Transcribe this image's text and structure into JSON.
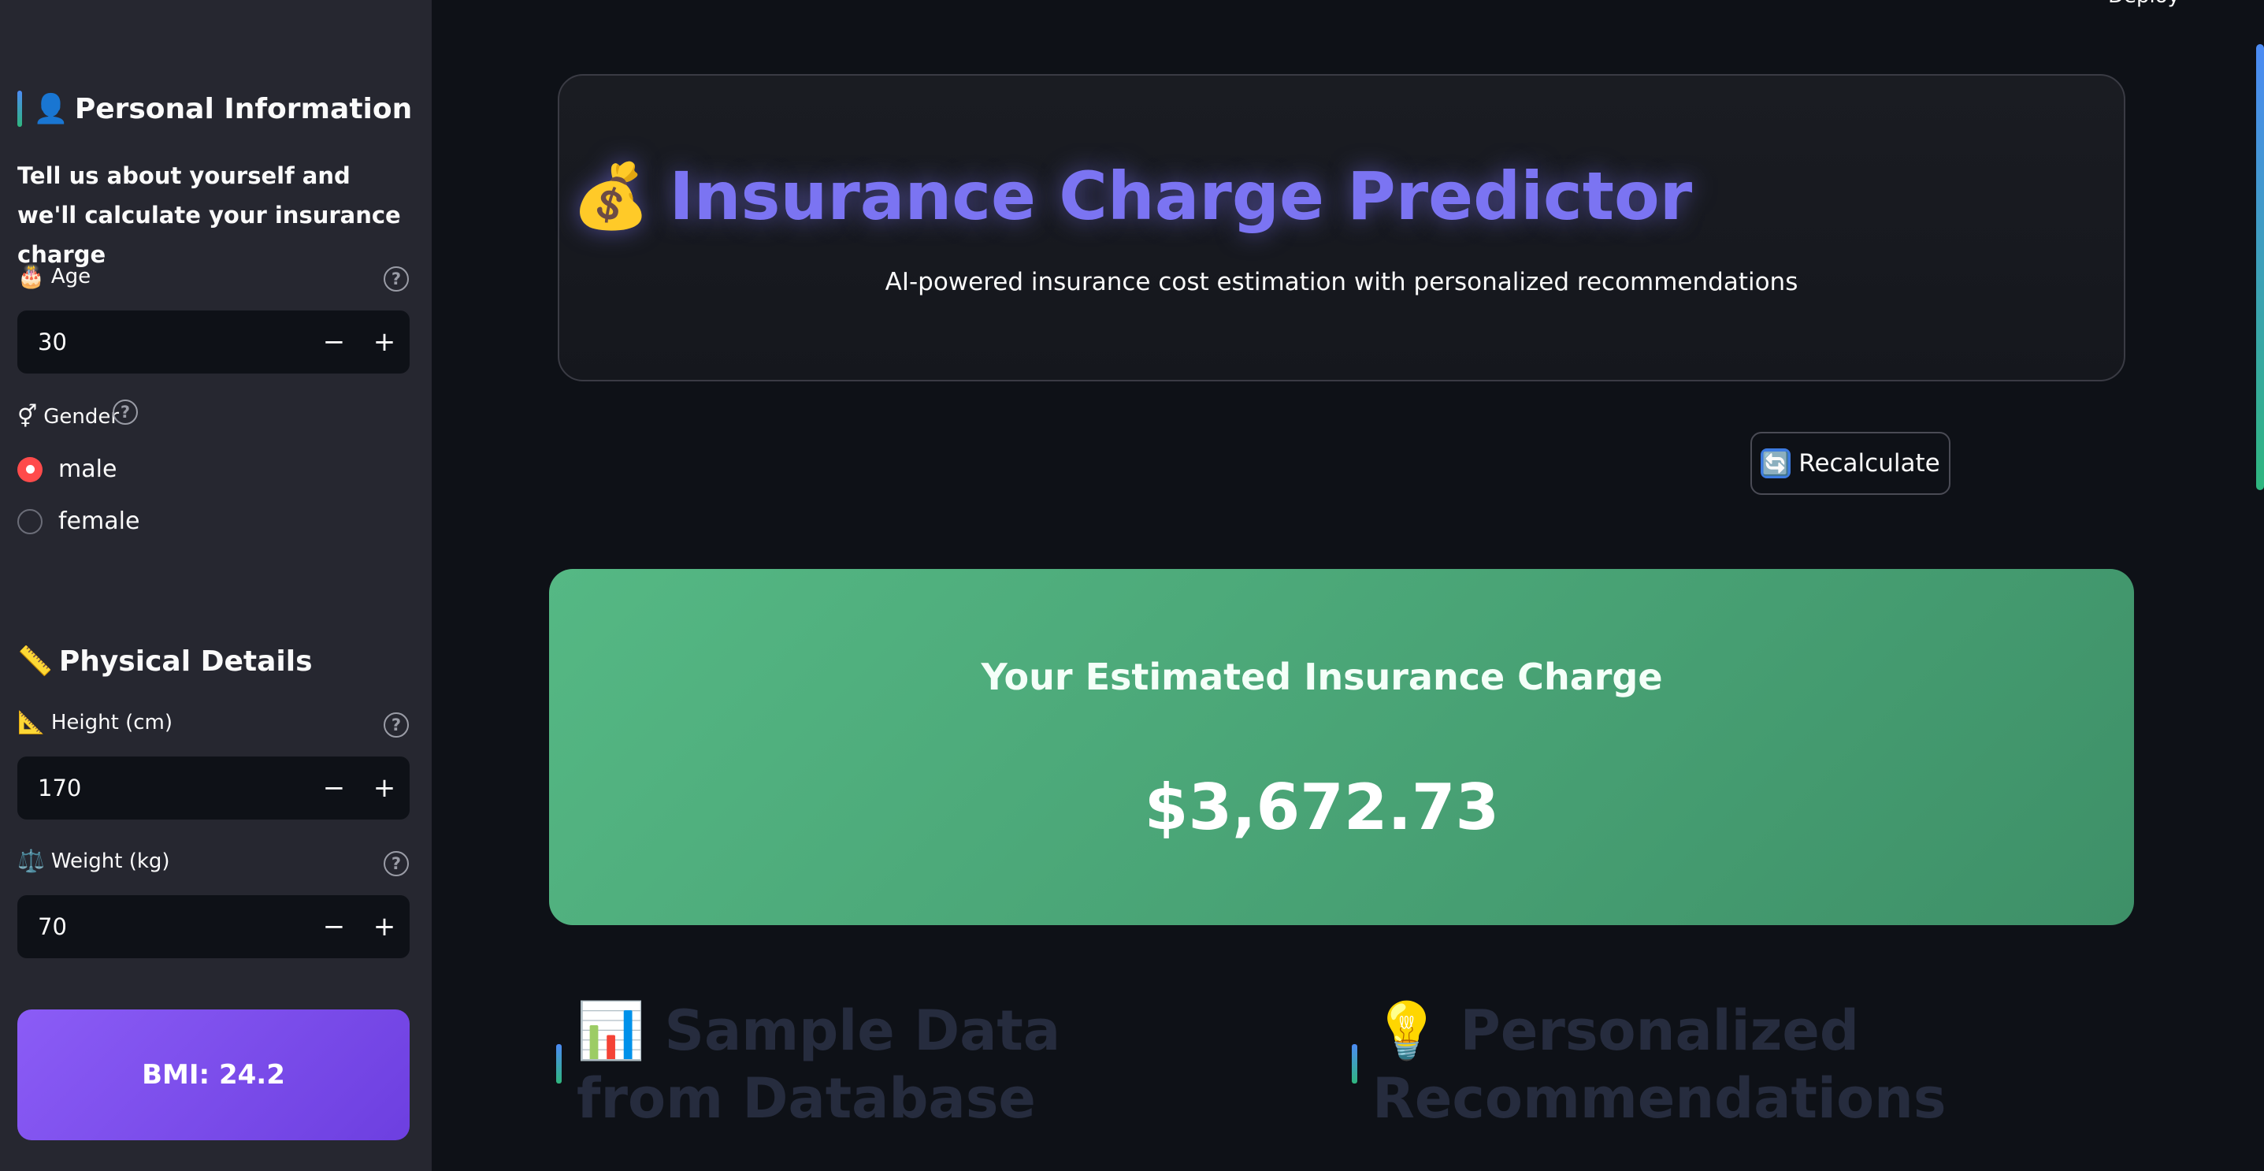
{
  "sidebar": {
    "personal": {
      "icon": "👤",
      "title": "Personal Information",
      "intro": "Tell us about yourself and we'll calculate your insurance charge"
    },
    "age": {
      "icon": "🎂",
      "label": "Age",
      "value": "30"
    },
    "gender": {
      "icon": "⚥",
      "label": "Gender",
      "options": [
        "male",
        "female"
      ],
      "selected": "male"
    },
    "physical": {
      "icon": "📏",
      "title": "Physical Details"
    },
    "height": {
      "icon": "📐",
      "label": "Height (cm)",
      "value": "170"
    },
    "weight": {
      "icon": "⚖️",
      "label": "Weight (kg)",
      "value": "70"
    },
    "bmi": "BMI: 24.2",
    "step_minus": "−",
    "step_plus": "+",
    "help": "?"
  },
  "header": {
    "icon": "💰",
    "title": "Insurance Charge Predictor",
    "subtitle": "AI-powered insurance cost estimation with personalized recommendations"
  },
  "toolbar": {
    "deploy": "Deploy"
  },
  "recalculate": {
    "icon": "🔄",
    "label": "Recalculate"
  },
  "result": {
    "label": "Your Estimated Insurance Charge",
    "value": "$3,672.73"
  },
  "sections": {
    "sample": {
      "icon": "📊",
      "title": "Sample Data from Database"
    },
    "recommendations": {
      "icon": "💡",
      "title": "Personalized Recommendations"
    }
  }
}
